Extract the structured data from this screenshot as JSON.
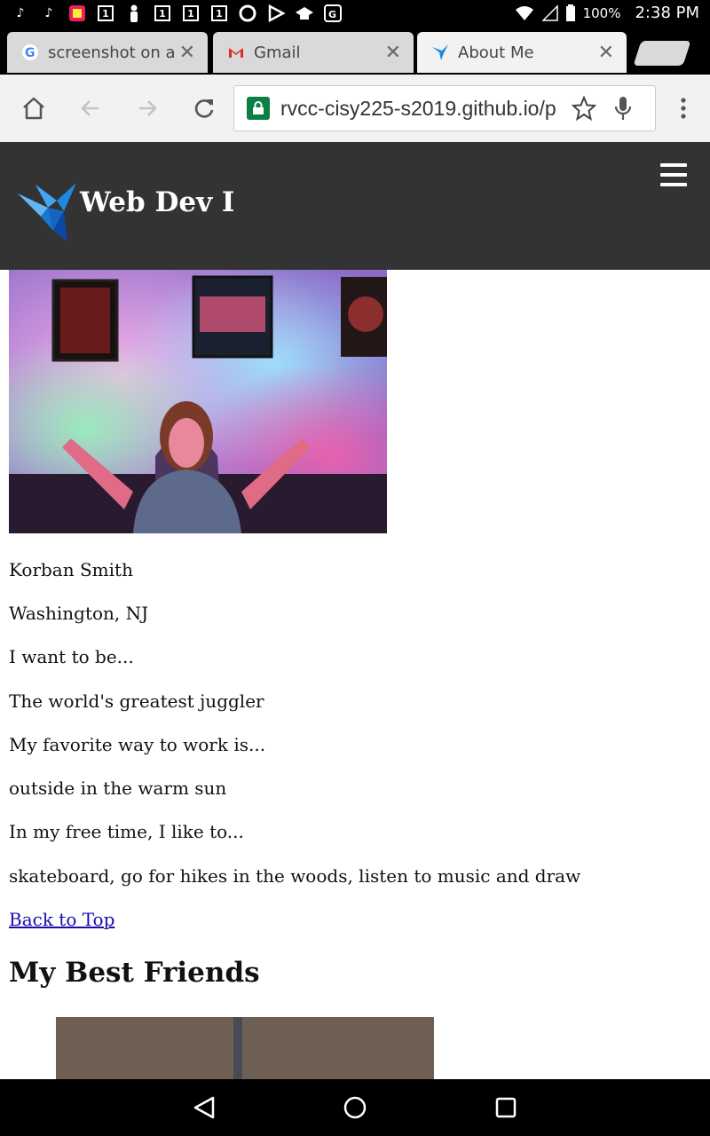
{
  "status": {
    "battery": "100%",
    "time": "2:38 PM",
    "left_icons": [
      "tiktok-icon",
      "tiktok-icon",
      "photo-app-icon",
      "calendar-icon",
      "person-icon",
      "calendar-icon",
      "calendar-icon",
      "calendar-icon",
      "sync-icon",
      "play-store-icon",
      "cap-icon",
      "maps-icon"
    ],
    "calendar_digit": "1"
  },
  "tabs": [
    {
      "title": "screenshot on at&",
      "icon": "google-icon"
    },
    {
      "title": "Gmail",
      "icon": "gmail-icon"
    },
    {
      "title": "About Me",
      "icon": "hummingbird-icon"
    }
  ],
  "tab_close": "✕",
  "omnibox": {
    "url": "rvcc-cisy225-s2019.github.io/p"
  },
  "site": {
    "title": "Web Dev I"
  },
  "profile": {
    "name": "Korban Smith",
    "location": "Washington, NJ",
    "want_prompt": "I want to be...",
    "want_answer": "The world's greatest juggler",
    "work_prompt": "My favorite way to work is...",
    "work_answer": "outside in the warm sun",
    "free_prompt": "In my free time, I like to...",
    "free_answer": "skateboard, go for hikes in the woods, listen to music and draw",
    "back_link": "Back to Top"
  },
  "friends": {
    "heading": "My Best Friends"
  },
  "colors": {
    "header_bg": "#333333",
    "link": "#1a0dab",
    "lock": "#0b8043",
    "logo_blue": "#1e88e5"
  }
}
